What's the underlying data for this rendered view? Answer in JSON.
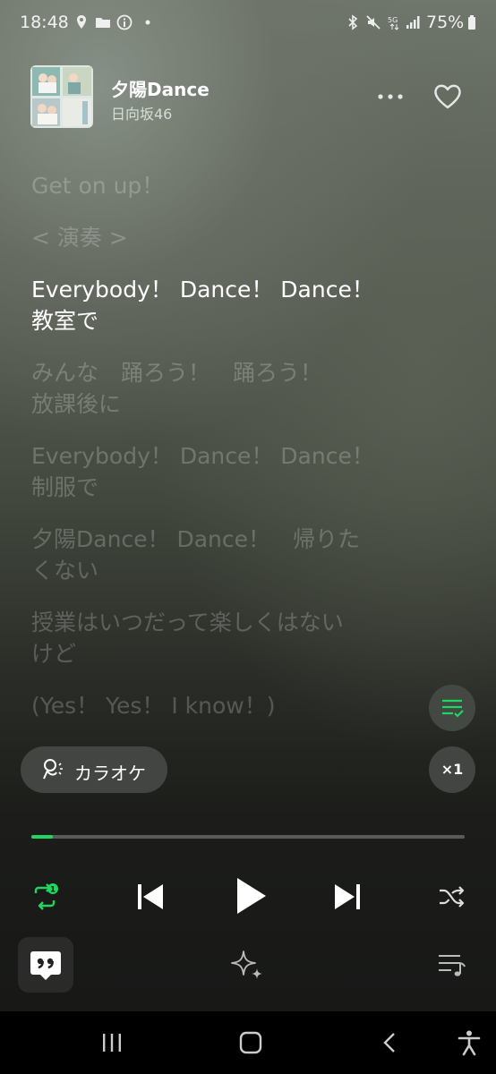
{
  "status_bar": {
    "time": "18:48",
    "battery": "75%",
    "network": "5G"
  },
  "track": {
    "title": "夕陽Dance",
    "artist": "日向坂46",
    "progress_fraction": 0.05
  },
  "lyrics": [
    {
      "text": "Get on up！",
      "active": false
    },
    {
      "text": "< 演奏 >",
      "active": false
    },
    {
      "text": "Everybody！ Dance！ Dance！\n教室で",
      "active": true
    },
    {
      "text": "みんな　踊ろう！　踊ろう！\n放課後に",
      "active": false
    },
    {
      "text": "Everybody！ Dance！ Dance！\n制服で",
      "active": false
    },
    {
      "text": "夕陽Dance！ Dance！　帰りた\nくない",
      "active": false
    },
    {
      "text": "授業はいつだって楽しくはない\nけど",
      "active": false
    },
    {
      "text": "(Yes！ Yes！ I know！)",
      "active": false
    }
  ],
  "karaoke": {
    "label": "カラオケ"
  },
  "playback_speed": {
    "label": "×1"
  },
  "repeat_badge": "1",
  "colors": {
    "accent": "#1ed760",
    "inactive_lyric": "rgba(255,255,255,0.22)"
  }
}
